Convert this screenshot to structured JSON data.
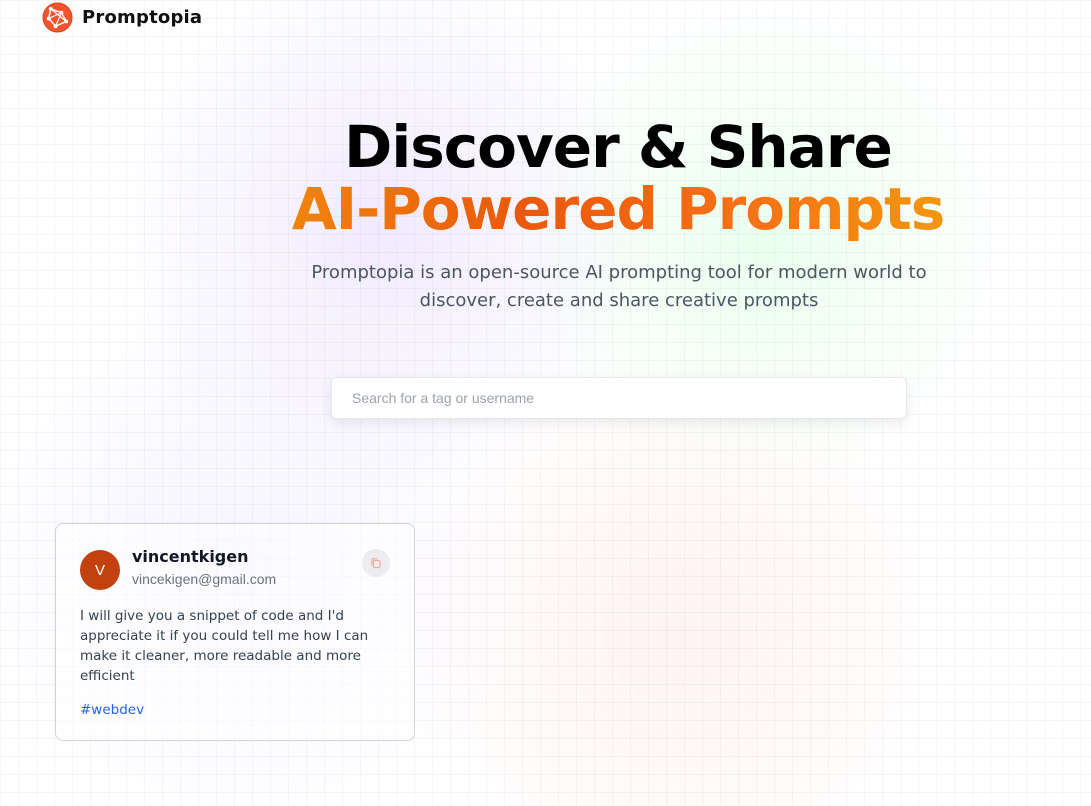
{
  "nav": {
    "brand": "Promptopia",
    "logo_icon": "globe-network-icon"
  },
  "hero": {
    "title_line1": "Discover & Share",
    "title_line2": "AI-Powered Prompts",
    "subtitle": "Promptopia is an open-source AI prompting tool for modern world to discover, create and share creative prompts"
  },
  "search": {
    "placeholder": "Search for a tag or username",
    "value": ""
  },
  "prompts": [
    {
      "avatar_initial": "V",
      "username": "vincentkigen",
      "email": "vincekigen@gmail.com",
      "prompt": "I will give you a snippet of code and I'd appreciate it if you could tell me how I can make it cleaner, more readable and more efficient",
      "tag": "#webdev",
      "copy_icon": "copy-icon"
    }
  ],
  "colors": {
    "accent_orange": "#ea580c",
    "avatar_bg": "#c2410c",
    "tag_blue": "#2563eb"
  }
}
